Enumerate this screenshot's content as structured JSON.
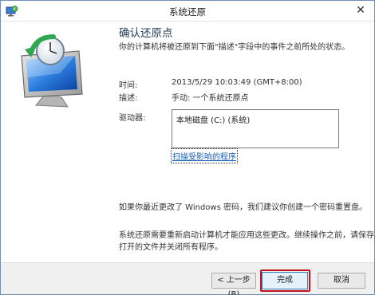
{
  "window": {
    "title": "系统还原",
    "close_glyph": "✕"
  },
  "page": {
    "heading": "确认还原点",
    "intro": "你的计算机将被还原到下面\"描述\"字段中的事件之前所处的状态。"
  },
  "details": {
    "time_label": "时间:",
    "time_value": "2013/5/29 10:03:49 (GMT+8:00)",
    "desc_label": "描述:",
    "desc_value": "手动: 一个系统还原点",
    "drive_label": "驱动器:",
    "drives": [
      "本地磁盘 (C:) (系统)"
    ],
    "scan_link": "扫描受影响的程序"
  },
  "notes": {
    "password_note": "如果你最近更改了 Windows 密码，我们建议你创建一个密码重置盘。",
    "restart_note_line1": "系统还原需要重新启动计算机才能应用这些更改。继续操作之前，请保存所有",
    "restart_note_line2": "打开的文件并关闭所有程序。"
  },
  "buttons": {
    "back": "< 上一步(B)",
    "finish": "完成",
    "cancel": "取消"
  },
  "icons": {
    "title_icon": "system-restore-icon",
    "illustration": "monitor-restore-icon"
  },
  "colors": {
    "heading": "#1e395b",
    "link": "#1a5fb4",
    "highlight_frame": "#c0141e",
    "footer_bg": "#f0f0f0"
  }
}
